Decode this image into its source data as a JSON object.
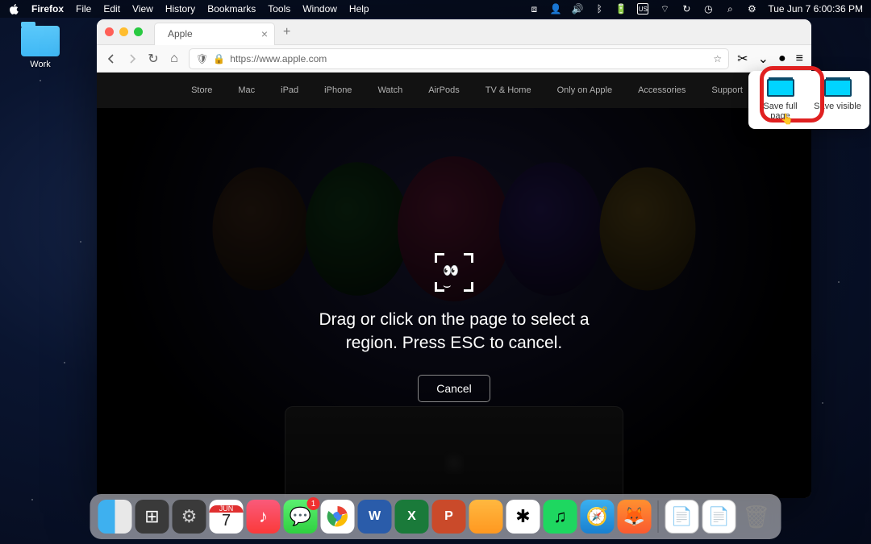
{
  "menubar": {
    "app": "Firefox",
    "items": [
      "File",
      "Edit",
      "View",
      "History",
      "Bookmarks",
      "Tools",
      "Window",
      "Help"
    ],
    "clock": "Tue Jun 7  6:00:36 PM"
  },
  "desktop": {
    "folder_label": "Work"
  },
  "browser": {
    "tab_title": "Apple",
    "url": "https://www.apple.com"
  },
  "apple_nav": [
    "Store",
    "Mac",
    "iPad",
    "iPhone",
    "Watch",
    "AirPods",
    "TV & Home",
    "Only on Apple",
    "Accessories",
    "Support"
  ],
  "screenshot_overlay": {
    "line1": "Drag or click on the page to select a",
    "line2": "region. Press ESC to cancel.",
    "cancel": "Cancel"
  },
  "popup": {
    "full": "Save full page",
    "visible": "Save visible"
  },
  "calendar": {
    "month": "JUN",
    "day": "7"
  },
  "messages_badge": "1"
}
